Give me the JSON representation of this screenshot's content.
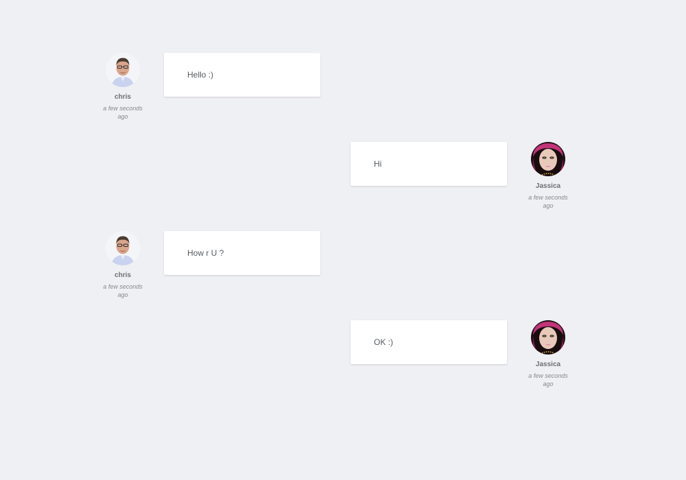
{
  "messages": [
    {
      "author": "chris",
      "time": "a few seconds ago",
      "text": "Hello :)",
      "side": "left"
    },
    {
      "author": "Jassica",
      "time": "a few seconds ago",
      "text": "Hi",
      "side": "right"
    },
    {
      "author": "chris",
      "time": "a few seconds ago",
      "text": "How r U ?",
      "side": "left"
    },
    {
      "author": "Jassica",
      "time": "a few seconds ago",
      "text": "OK :)",
      "side": "right"
    }
  ]
}
